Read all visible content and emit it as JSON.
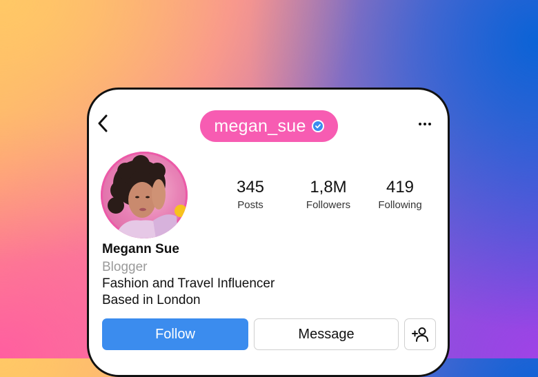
{
  "header": {
    "username": "megan_sue",
    "back_icon": "chevron-left-icon",
    "verified_icon": "verified-badge-icon",
    "more_icon": "more-horizontal-icon"
  },
  "colors": {
    "pill": "#f75cb2",
    "follow": "#3b8cee",
    "verified": "#3a8cf0"
  },
  "stats": [
    {
      "value": "345",
      "label": "Posts"
    },
    {
      "value": "1,8M",
      "label": "Followers"
    },
    {
      "value": "419",
      "label": "Following"
    }
  ],
  "profile": {
    "name": "Megann Sue",
    "role": "Blogger",
    "bio_line1": "Fashion and Travel Influencer",
    "bio_line2": "Based in London"
  },
  "actions": {
    "follow_label": "Follow",
    "message_label": "Message",
    "add_user_icon": "add-user-icon"
  }
}
